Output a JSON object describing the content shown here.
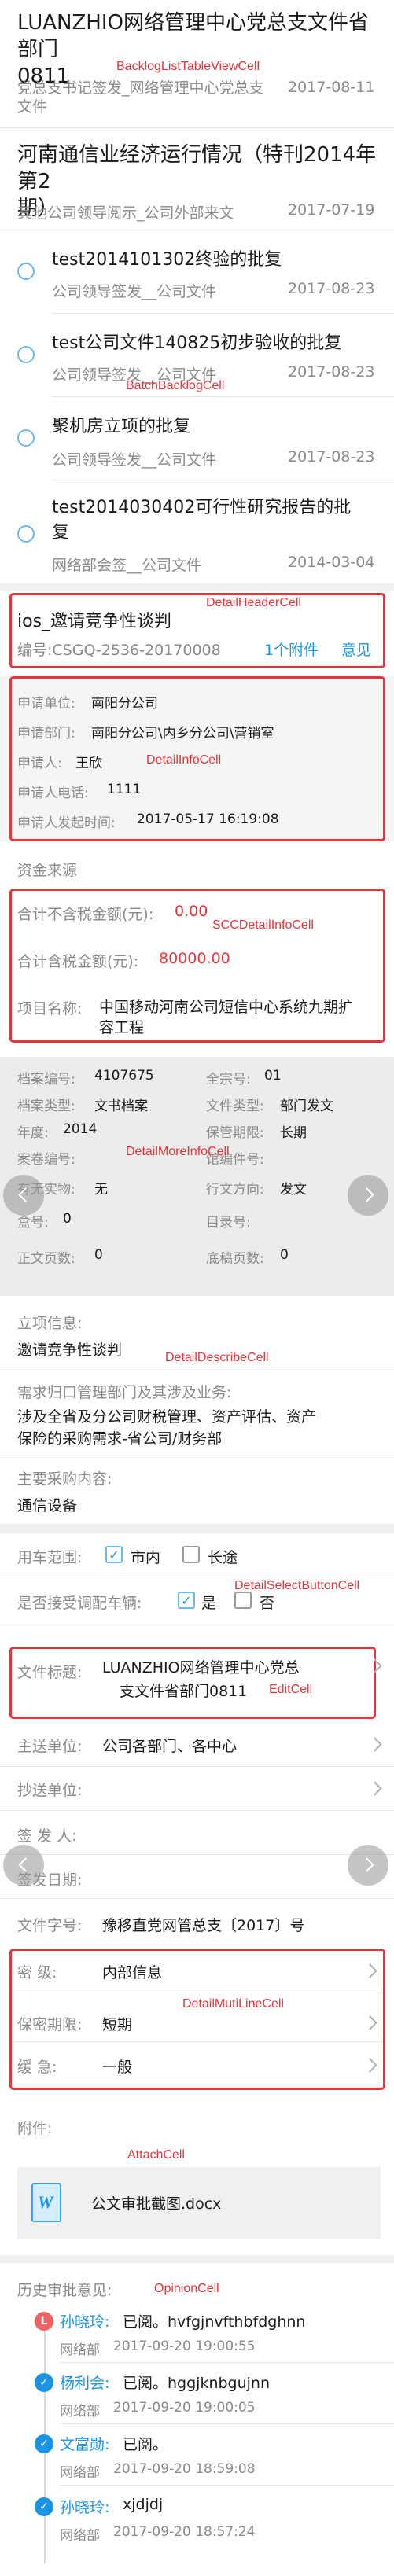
{
  "backlog": {
    "cell_label": "BacklogListTableViewCell",
    "items": [
      {
        "title_line1": "LUANZHIO网络管理中心党总支文件省部门",
        "title_line2": "0811",
        "sub_line1": "党总支书记签发_网络管理中心党总支",
        "sub_line2": "文件",
        "date": "2017-08-11"
      },
      {
        "title_line1": "河南通信业经济运行情况（特刊2014年第2",
        "title_line2": "期）",
        "sub_line1": "其他公司领导阅示_公司外部来文",
        "date": "2017-07-19"
      }
    ]
  },
  "batch": {
    "cell_label": "BatchBacklogCell",
    "items": [
      {
        "title": "test2014101302终验的批复",
        "sub": "公司领导签发__公司文件",
        "date": "2017-08-23"
      },
      {
        "title": "test公司文件140825初步验收的批复",
        "sub": "公司领导签发__公司文件",
        "date": "2017-08-23"
      },
      {
        "title": "聚机房立项的批复",
        "sub": "公司领导签发__公司文件",
        "date": "2017-08-23"
      },
      {
        "title_line1": "test2014030402可行性研究报告的批",
        "title_line2": "复",
        "sub": "网络部会签__公司文件",
        "date": "2014-03-04"
      }
    ]
  },
  "detail_header": {
    "cell_label": "DetailHeaderCell",
    "title": "ios_邀请竞争性谈判",
    "number": "编号:CSGQ-2536-20170008",
    "attachments": "1个附件",
    "opinion": "意见"
  },
  "detail_info": {
    "cell_label": "DetailInfoCell",
    "rows": [
      {
        "label": "申请单位:",
        "value": "南阳分公司"
      },
      {
        "label": "申请部门:",
        "value": "南阳分公司\\内乡分公司\\营销室"
      },
      {
        "label": "申请人:",
        "value": "王欣"
      },
      {
        "label": "申请人电话:",
        "value": "1111"
      },
      {
        "label": "申请人发起时间:",
        "value": "2017-05-17 16:19:08"
      }
    ]
  },
  "funding": {
    "title": "资金来源"
  },
  "scc": {
    "cell_label": "SCCDetailInfoCell",
    "rows": [
      {
        "label": "合计不含税金额(元):",
        "value": "0.00"
      },
      {
        "label": "合计含税金额(元):",
        "value": "80000.00"
      }
    ],
    "project_label": "项目名称:",
    "project_line1": "中国移动河南公司短信中心系统九期扩",
    "project_line2": "容工程"
  },
  "more_info": {
    "cell_label": "DetailMoreInfoCell",
    "left": [
      {
        "label": "档案编号:",
        "value": "4107675"
      },
      {
        "label": "档案类型:",
        "value": "文书档案"
      },
      {
        "label": "年度:",
        "value": "2014"
      },
      {
        "label": "案卷编号:",
        "value": ""
      },
      {
        "label": "有无实物:",
        "value": "无"
      },
      {
        "label": "盒号:",
        "value": "0"
      },
      {
        "label": "正文页数:",
        "value": "0"
      }
    ],
    "right": [
      {
        "label": "全宗号:",
        "value": "01"
      },
      {
        "label": "文件类型:",
        "value": "部门发文"
      },
      {
        "label": "保管期限:",
        "value": "长期"
      },
      {
        "label": "馆编件号:",
        "value": ""
      },
      {
        "label": "行文方向:",
        "value": "发文"
      },
      {
        "label": "目录号:",
        "value": ""
      },
      {
        "label": "底稿页数:",
        "value": "0"
      }
    ]
  },
  "describe": {
    "cell_label": "DetailDescribeCell",
    "items": [
      {
        "label": "立项信息:",
        "lines": [
          "邀请竞争性谈判"
        ]
      },
      {
        "label": "需求归口管理部门及其涉及业务:",
        "lines": [
          "涉及全省及分公司财税管理、资产评估、资产",
          "保险的采购需求-省公司/财务部"
        ]
      },
      {
        "label": "主要采购内容:",
        "lines": [
          "通信设备"
        ]
      }
    ]
  },
  "select": {
    "cell_label": "DetailSelectButtonCell",
    "row1_label": "用车范围:",
    "row1_opt1": "市内",
    "row1_opt2": "长途",
    "row2_label": "是否接受调配车辆:",
    "row2_opt1": "是",
    "row2_opt2": "否"
  },
  "edit": {
    "cell_label": "EditCell",
    "label": "文件标题:",
    "line1": "LUANZHIO网络管理中心党总",
    "line2": "支文件省部门0811"
  },
  "fields": [
    {
      "label": "主送单位:",
      "value": "公司各部门、各中心"
    },
    {
      "label": "抄送单位:",
      "value": ""
    },
    {
      "label": "签 发 人:",
      "value": ""
    },
    {
      "label": "签发日期:",
      "value": ""
    },
    {
      "label": "文件字号:",
      "value": "豫移直党网管总支〔2017〕号"
    }
  ],
  "multiline": {
    "cell_label": "DetailMutiLineCell",
    "rows": [
      {
        "label": "密      级:",
        "value": "内部信息"
      },
      {
        "label": "保密期限:",
        "value": "短期"
      },
      {
        "label": "缓      急:",
        "value": "一般"
      }
    ]
  },
  "attach": {
    "title": "附件:",
    "cell_label": "AttachCell",
    "file_name": "公文审批截图.docx",
    "file_icon_letter": "W"
  },
  "opinion": {
    "title": "历史审批意见:",
    "cell_label": "OpinionCell",
    "items": [
      {
        "icon": "L",
        "name": "孙晓玲:",
        "text": "已阅。hvfgjnvfthbfdghnn",
        "dept": "网络部",
        "time": "2017-09-20 19:00:55",
        "color": "#f06262"
      },
      {
        "icon": "✓",
        "name": "杨利会:",
        "text": "已阅。hggjknbgujnn",
        "dept": "网络部",
        "time": "2017-09-20 19:00:05",
        "color": "#1a95e6"
      },
      {
        "icon": "✓",
        "name": "文富勋:",
        "text": "已阅。",
        "dept": "网络部",
        "time": "2017-09-20 18:59:08",
        "color": "#1a95e6"
      },
      {
        "icon": "✓",
        "name": "孙晓玲:",
        "text": "xjdjdj",
        "dept": "网络部",
        "time": "2017-09-20 18:57:24",
        "color": "#1a95e6"
      }
    ]
  },
  "colors": {
    "accent": "#1a95e6",
    "annotation": "#e8333a",
    "amount": "#e8333a"
  }
}
